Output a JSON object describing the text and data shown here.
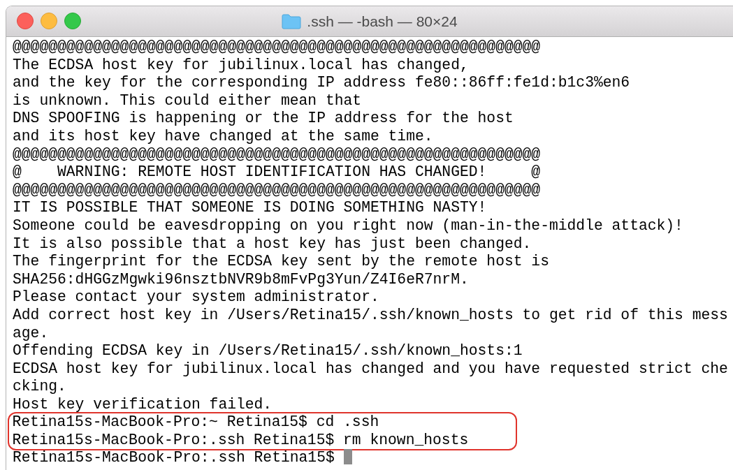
{
  "window": {
    "title": ".ssh — -bash — 80×24"
  },
  "lines": [
    {
      "text": "@@@@@@@@@@@@@@@@@@@@@@@@@@@@@@@@@@@@@@@@@@@@@@@@@@@@@@@@@@@",
      "highlighted": false
    },
    {
      "text": "The ECDSA host key for jubilinux.local has changed,",
      "highlighted": false
    },
    {
      "text": "and the key for the corresponding IP address fe80::86ff:fe1d:b1c3%en6",
      "highlighted": false
    },
    {
      "text": "is unknown. This could either mean that",
      "highlighted": false
    },
    {
      "text": "DNS SPOOFING is happening or the IP address for the host",
      "highlighted": false
    },
    {
      "text": "and its host key have changed at the same time.",
      "highlighted": false
    },
    {
      "text": "@@@@@@@@@@@@@@@@@@@@@@@@@@@@@@@@@@@@@@@@@@@@@@@@@@@@@@@@@@@",
      "highlighted": false
    },
    {
      "text": "@    WARNING: REMOTE HOST IDENTIFICATION HAS CHANGED!     @",
      "highlighted": false
    },
    {
      "text": "@@@@@@@@@@@@@@@@@@@@@@@@@@@@@@@@@@@@@@@@@@@@@@@@@@@@@@@@@@@",
      "highlighted": false
    },
    {
      "text": "IT IS POSSIBLE THAT SOMEONE IS DOING SOMETHING NASTY!",
      "highlighted": false
    },
    {
      "text": "Someone could be eavesdropping on you right now (man-in-the-middle attack)!",
      "highlighted": false
    },
    {
      "text": "It is also possible that a host key has just been changed.",
      "highlighted": false
    },
    {
      "text": "The fingerprint for the ECDSA key sent by the remote host is",
      "highlighted": false
    },
    {
      "text": "SHA256:dHGGzMgwki96nsztbNVR9b8mFvPg3Yun/Z4I6eR7nrM.",
      "highlighted": false
    },
    {
      "text": "Please contact your system administrator.",
      "highlighted": false
    },
    {
      "text": "Add correct host key in /Users/Retina15/.ssh/known_hosts to get rid of this mess",
      "highlighted": false
    },
    {
      "text": "age.",
      "highlighted": false
    },
    {
      "text": "Offending ECDSA key in /Users/Retina15/.ssh/known_hosts:1",
      "highlighted": false
    },
    {
      "text": "ECDSA host key for jubilinux.local has changed and you have requested strict che",
      "highlighted": false
    },
    {
      "text": "cking.",
      "highlighted": false
    },
    {
      "text": "Host key verification failed.",
      "highlighted": false
    },
    {
      "text": "Retina15s-MacBook-Pro:~ Retina15$ cd .ssh",
      "highlighted": true
    },
    {
      "text": "Retina15s-MacBook-Pro:.ssh Retina15$ rm known_hosts",
      "highlighted": true
    },
    {
      "text": "Retina15s-MacBook-Pro:.ssh Retina15$",
      "highlighted": false,
      "cursor": true
    }
  ]
}
